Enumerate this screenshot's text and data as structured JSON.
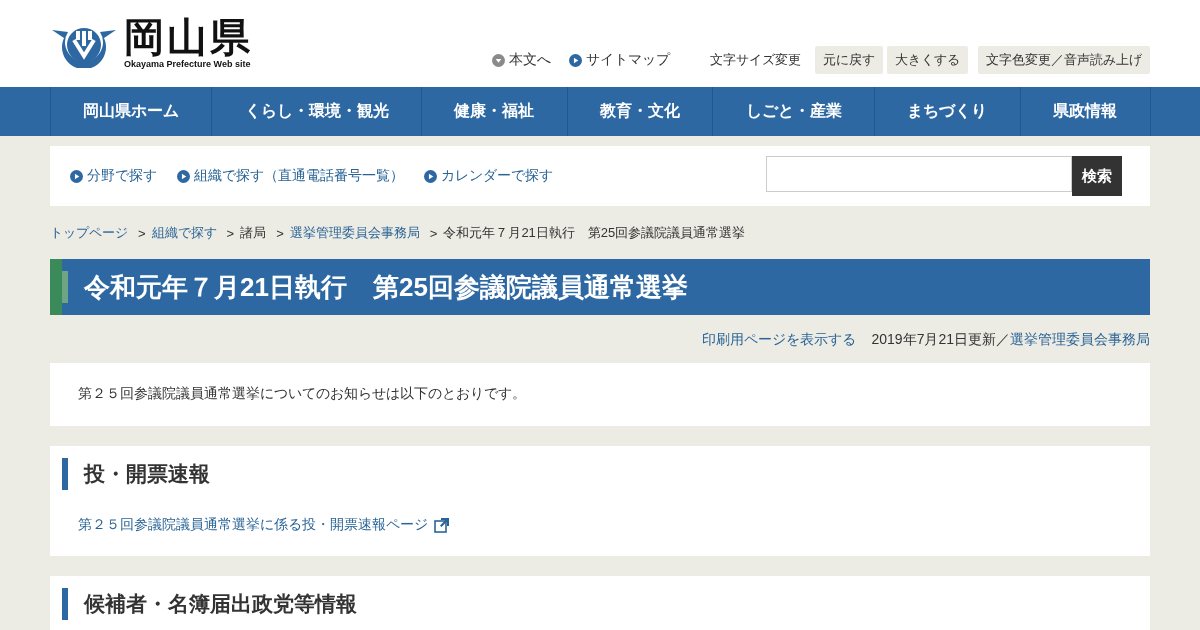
{
  "header": {
    "logo_title": "岡山県",
    "logo_subtitle": "Okayama Prefecture Web site",
    "links": [
      {
        "label": "本文へ",
        "kind": "down"
      },
      {
        "label": "サイトマップ",
        "kind": "right"
      }
    ],
    "font_size_label": "文字サイズ変更",
    "buttons": [
      "元に戻す",
      "大きくする",
      "文字色変更／音声読み上げ"
    ]
  },
  "nav": [
    "岡山県ホーム",
    "くらし・環境・観光",
    "健康・福祉",
    "教育・文化",
    "しごと・産業",
    "まちづくり",
    "県政情報"
  ],
  "search_bar": {
    "links": [
      "分野で探す",
      "組織で探す（直通電話番号一覧）",
      "カレンダーで探す"
    ],
    "button": "検索"
  },
  "breadcrumb": {
    "separator": ">",
    "items": [
      {
        "label": "トップページ",
        "link": true
      },
      {
        "label": "組織で探す",
        "link": true
      },
      {
        "label": "諸局",
        "link": false
      },
      {
        "label": "選挙管理委員会事務局",
        "link": true
      },
      {
        "label": "令和元年７月21日執行　第25回参議院議員通常選挙",
        "link": false
      }
    ]
  },
  "page_title": "令和元年７月21日執行　第25回参議院議員通常選挙",
  "meta": {
    "print_link": "印刷用ページを表示する",
    "updated": "2019年7月21日更新／",
    "department": "選挙管理委員会事務局"
  },
  "intro": "第２５回参議院議員通常選挙についてのお知らせは以下のとおりです。",
  "sections": [
    {
      "heading": "投・開票速報",
      "links": [
        {
          "label": "第２５回参議院議員通常選挙に係る投・開票速報ページ",
          "external": true
        }
      ]
    },
    {
      "heading": "候補者・名簿届出政党等情報"
    }
  ]
}
